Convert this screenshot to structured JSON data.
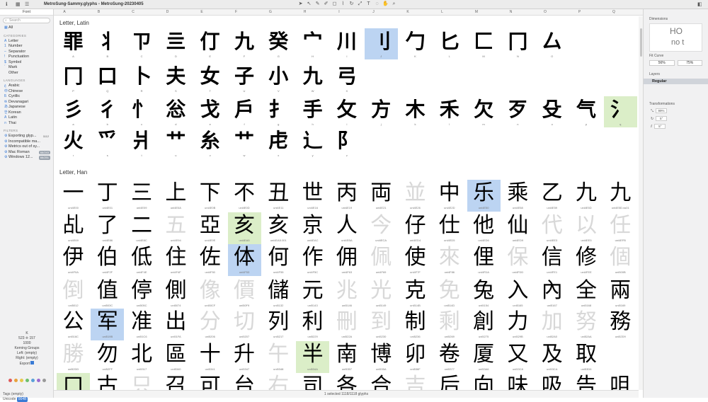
{
  "window": {
    "title": "MetroSung-Sammy.glyphs - MetroSung-20230405"
  },
  "sidebar": {
    "tabs": [
      "Font"
    ],
    "search_placeholder": "Search",
    "all_label": "All",
    "categories_head": "CATEGORIES",
    "categories": [
      {
        "icon": "A",
        "label": "Letter"
      },
      {
        "icon": "1",
        "label": "Number"
      },
      {
        "icon": "–",
        "label": "Separator"
      },
      {
        "icon": "!",
        "label": "Punctuation"
      },
      {
        "icon": "$",
        "label": "Symbol"
      },
      {
        "icon": "´",
        "label": "Mark"
      },
      {
        "icon": "",
        "label": "Other"
      }
    ],
    "languages_head": "LANGUAGES",
    "languages": [
      {
        "icon": "ع",
        "label": "Arabic"
      },
      {
        "icon": "中",
        "label": "Chinese"
      },
      {
        "icon": "Б",
        "label": "Cyrillic"
      },
      {
        "icon": "क",
        "label": "Devanagari"
      },
      {
        "icon": "あ",
        "label": "Japanese"
      },
      {
        "icon": "한",
        "label": "Korean"
      },
      {
        "icon": "A",
        "label": "Latin"
      },
      {
        "icon": "ก",
        "label": "Thai"
      }
    ],
    "filters_head": "FILTERS",
    "filters": [
      {
        "label": "Exporting glyp...",
        "count": "1112"
      },
      {
        "label": "Incompatible ma...",
        "count": ""
      },
      {
        "label": "Metrics out of sy...",
        "count": ""
      },
      {
        "label": "Mac Roman",
        "count": "66/243"
      },
      {
        "label": "Windows 12...",
        "count": "66/251"
      }
    ],
    "kerning": {
      "glyph": "K",
      "left_val": "523",
      "right_val": "157",
      "width": "1000",
      "groups_label": "Kerning Groups",
      "left": "Left: (empty)",
      "right": "Right: (empty)",
      "export_label": "Export"
    },
    "tags_label": "Tags (empty)",
    "unicode_label": "Unicode",
    "unicode_value": "004B"
  },
  "columns": [
    "A",
    "B",
    "C",
    "D",
    "E",
    "F",
    "G",
    "H",
    "I",
    "J",
    "K",
    "L",
    "M",
    "N",
    "O",
    "P",
    "Q",
    "R",
    "S",
    "T",
    "U",
    "V",
    "W",
    "X",
    "Y",
    "Z"
  ],
  "sections": {
    "latin": "Letter, Latin",
    "han": "Letter, Han"
  },
  "latin_rows": [
    {
      "glyphs": [
        "罪",
        "丬",
        "ㄗ",
        "亖",
        "仃",
        "九",
        "癸",
        "宀",
        "川",
        "刂",
        "勹",
        "匕",
        "匚",
        "冂",
        "厶"
      ],
      "names": [
        "A",
        "B",
        "C",
        "D",
        "E",
        "F",
        "G",
        "H",
        "I",
        "J",
        "K",
        "L",
        "M",
        "N",
        "O"
      ]
    },
    {
      "glyphs": [
        "冂",
        "口",
        "卜",
        "夫",
        "女",
        "子",
        "小",
        "九",
        "弓"
      ],
      "names": [
        "P",
        "Q",
        "R",
        "S",
        "T",
        "U",
        "V",
        "W",
        "X"
      ]
    },
    {
      "glyphs": [
        "彡",
        "彳",
        "忄",
        "忩",
        "戈",
        "戶",
        "扌",
        "手",
        "攵",
        "方",
        "木",
        "禾",
        "欠",
        "歹",
        "殳",
        "气",
        "氵"
      ],
      "names": [
        "a",
        "b",
        "c",
        "d",
        "e",
        "f",
        "g",
        "h",
        "i",
        "j",
        "k",
        "l",
        "m",
        "n",
        "o",
        "p",
        "q"
      ]
    },
    {
      "glyphs": [
        "火",
        "爫",
        "爿",
        "艹",
        "糸",
        "艹",
        "虍",
        "辶",
        "阝"
      ],
      "names": [
        "r",
        "s",
        "t",
        "u",
        "v",
        "w",
        "x",
        "y",
        "z"
      ]
    }
  ],
  "han_rows": [
    {
      "glyphs": [
        "一",
        "丁",
        "三",
        "上",
        "下",
        "不",
        "丑",
        "世",
        "丙",
        "両",
        "並",
        "中",
        "乐",
        "乘",
        "乙",
        "九",
        "九"
      ],
      "names": [
        "uni4E00",
        "uni4E01",
        "uni4E09",
        "uni4E0A",
        "uni4E0B",
        "uni4E0D",
        "uni4E11",
        "uni4E16",
        "uni4E19",
        "uni4E21",
        "uni4E26",
        "uni4E2D",
        "uni4E50",
        "uni4E58",
        "uni4E59",
        "uni4E5D",
        "uni4E5D.ss01"
      ]
    },
    {
      "glyphs": [
        "乩",
        "了",
        "二",
        "五",
        "亞",
        "亥",
        "亥",
        "京",
        "人",
        "今",
        "仔",
        "仕",
        "他",
        "仙",
        "代",
        "以",
        "任"
      ],
      "names": [
        "uni4E69",
        "uni4E86",
        "uni4E8C",
        "uni4E94",
        "uni4E9E",
        "uni4EA5",
        "uni4EA5.001",
        "uni4EAC",
        "uni4EBA",
        "uni4ECA",
        "uni4ED4",
        "uni4ED5",
        "uni4ED6",
        "uni4ED9",
        "uni4EE3",
        "uni4EE5",
        "uni4EFB"
      ]
    },
    {
      "glyphs": [
        "伊",
        "伯",
        "低",
        "住",
        "佐",
        "体",
        "何",
        "作",
        "佣",
        "佩",
        "使",
        "來",
        "俚",
        "保",
        "信",
        "修",
        "個"
      ],
      "names": [
        "uni4F0A",
        "uni4F2F",
        "uni4F4E",
        "uni4F4F",
        "uni4F50",
        "uni4F53",
        "uni4F55",
        "uni4F5C",
        "uni4F63",
        "uni4F69",
        "uni4F7F",
        "uni4F86",
        "uni4FDA",
        "uni4FDD",
        "uni4FE1",
        "uni4FEE",
        "uni500B"
      ]
    },
    {
      "glyphs": [
        "倒",
        "值",
        "停",
        "側",
        "像",
        "價",
        "儲",
        "元",
        "兆",
        "光",
        "克",
        "免",
        "兔",
        "入",
        "內",
        "全",
        "兩"
      ],
      "names": [
        "uni5012",
        "uni503C",
        "uni505C",
        "uni5074",
        "uni50CF",
        "uni50F9",
        "uni5132",
        "uni5143",
        "uni5146",
        "uni5149",
        "uni514B",
        "uni514D",
        "uni5154",
        "uni5165",
        "uni5167",
        "uni5168",
        "uni5169"
      ]
    },
    {
      "glyphs": [
        "公",
        "军",
        "准",
        "出",
        "分",
        "切",
        "列",
        "利",
        "刪",
        "到",
        "制",
        "剩",
        "創",
        "力",
        "加",
        "努",
        "務"
      ],
      "names": [
        "uni516C",
        "uni519B",
        "uni51C6",
        "uni51FA",
        "uni5206",
        "uni5207",
        "uni5217",
        "uni5229",
        "uni522A",
        "uni5230",
        "uni5236",
        "uni5269",
        "uni5275",
        "uni529B",
        "uni52A0",
        "uni52AA",
        "uni52D9"
      ]
    },
    {
      "glyphs": [
        "勝",
        "勿",
        "北",
        "區",
        "十",
        "升",
        "午",
        "半",
        "南",
        "博",
        "卯",
        "卷",
        "厦",
        "又",
        "及",
        "取"
      ],
      "names": [
        "uni52DD",
        "uni52FF",
        "uni5317",
        "uni5340",
        "uni5341",
        "uni5347",
        "uni5348",
        "uni534A",
        "uni5357",
        "uni535A",
        "uni536F",
        "uni5377",
        "uni53A6",
        "uni53C8",
        "uni53CA",
        "uni53D6"
      ]
    },
    {
      "glyphs": [
        "口",
        "古",
        "只",
        "召",
        "可",
        "台",
        "右",
        "司",
        "各",
        "合",
        "吉",
        "后",
        "向",
        "味",
        "吸",
        "告",
        "咀"
      ],
      "names": [
        "",
        "",
        "",
        "",
        "",
        "",
        "",
        "",
        "",
        "",
        "",
        "",
        "",
        "",
        "",
        "",
        ""
      ]
    }
  ],
  "gray_han": [
    "並",
    "五",
    "今",
    "代",
    "以",
    "任",
    "佩",
    "來",
    "保",
    "個",
    "倒",
    "像",
    "價",
    "兆",
    "光",
    "免",
    "分",
    "切",
    "刪",
    "到",
    "剩",
    "加",
    "努",
    "勝",
    "午",
    "只",
    "右",
    "吉"
  ],
  "status": "1 selected 1118/1118 glyphs",
  "inspector": {
    "dimensions": "Dimensions",
    "preview_a": "HO",
    "preview_b": "no t",
    "fit_curve": "Fit Curve",
    "fit_vals": [
      "56%",
      "75%"
    ],
    "layers": "Layers",
    "layer_name": "Regular",
    "transformations": "Transformations",
    "scale": "99%",
    "rot1": "5°",
    "rot2": "5°"
  }
}
